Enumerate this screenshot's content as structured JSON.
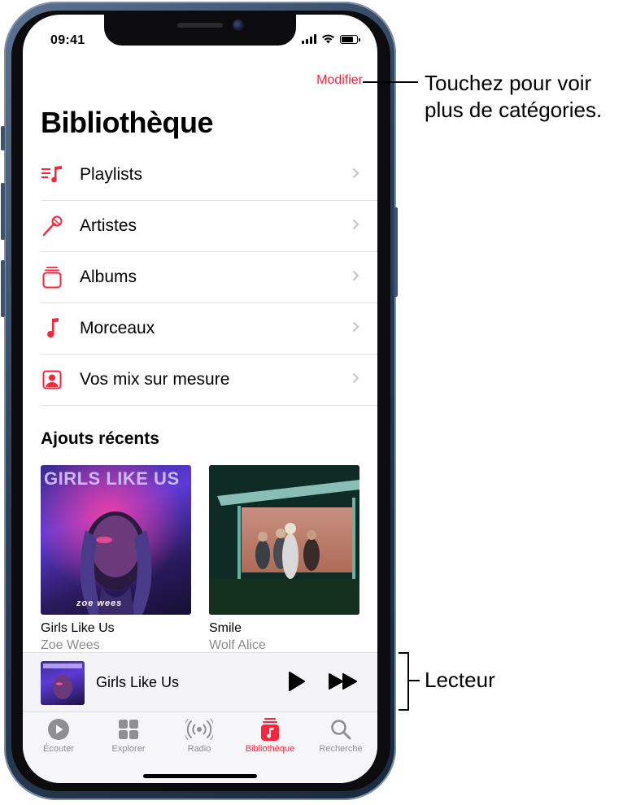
{
  "status_bar": {
    "time": "09:41",
    "battery_level": 0.85
  },
  "header": {
    "edit_label": "Modifier",
    "title": "Bibliothèque"
  },
  "library_items": [
    {
      "label": "Playlists",
      "icon": "playlist-icon"
    },
    {
      "label": "Artistes",
      "icon": "microphone-icon"
    },
    {
      "label": "Albums",
      "icon": "album-stack-icon"
    },
    {
      "label": "Morceaux",
      "icon": "music-note-icon"
    },
    {
      "label": "Vos mix sur mesure",
      "icon": "person-square-icon"
    }
  ],
  "recent": {
    "section_title": "Ajouts récents",
    "albums": [
      {
        "title": "Girls Like Us",
        "artist": "Zoe Wees",
        "cover_text": "GIRLS LIKE US",
        "cover_signature": "zoe wees"
      },
      {
        "title": "Smile",
        "artist": "Wolf Alice"
      }
    ]
  },
  "mini_player": {
    "title": "Girls Like Us",
    "play_icon": "play-icon",
    "forward_icon": "fast-forward-icon"
  },
  "tabs": [
    {
      "label": "Écouter",
      "icon": "play-circle-icon"
    },
    {
      "label": "Explorer",
      "icon": "grid-icon"
    },
    {
      "label": "Radio",
      "icon": "radio-waves-icon"
    },
    {
      "label": "Bibliothèque",
      "icon": "library-icon",
      "active": true
    },
    {
      "label": "Recherche",
      "icon": "search-icon"
    }
  ],
  "callouts": {
    "edit_line1": "Touchez pour voir",
    "edit_line2": "plus de catégories.",
    "player": "Lecteur"
  },
  "colors": {
    "accent": "#fa243c",
    "secondary_text": "#8a8a8e",
    "frame": "#2c3f58"
  }
}
